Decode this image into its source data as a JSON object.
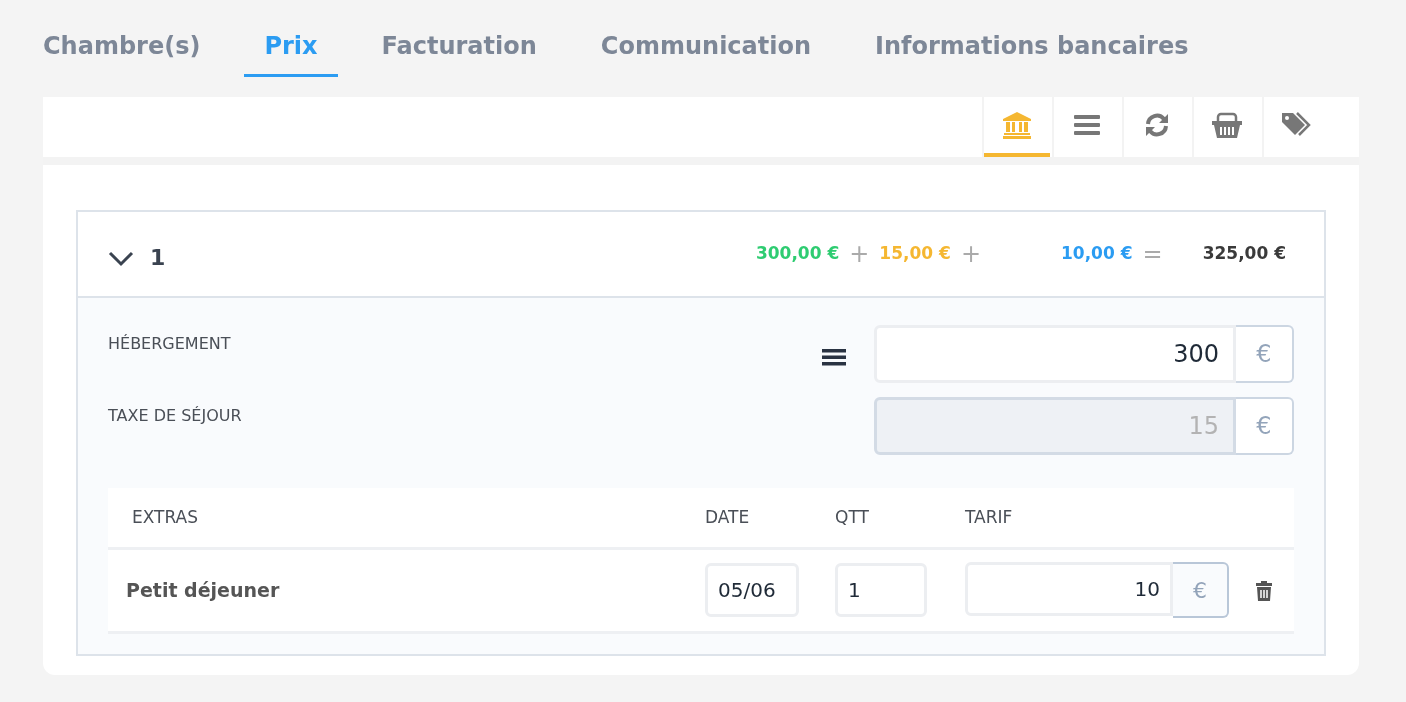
{
  "tabs": [
    {
      "label": "Chambre(s)",
      "selected": false
    },
    {
      "label": "Prix",
      "selected": true
    },
    {
      "label": "Facturation",
      "selected": false
    },
    {
      "label": "Communication",
      "selected": false
    },
    {
      "label": "Informations bancaires",
      "selected": false
    }
  ],
  "toolbar": [
    {
      "kind": "bank",
      "selected": true
    },
    {
      "kind": "list",
      "selected": false
    },
    {
      "kind": "refresh",
      "selected": false
    },
    {
      "kind": "basket",
      "selected": false
    },
    {
      "kind": "tags",
      "selected": false
    }
  ],
  "room": {
    "number": "1",
    "expanded": true,
    "summary": [
      {
        "amount": "300,00 €",
        "color": "#2ecc71",
        "operator": "+"
      },
      {
        "amount": "15,00 €",
        "color": "#f5b731",
        "operator": "+"
      },
      {
        "amount": "10,00 €",
        "color": "#2b9cf2",
        "operator": "="
      }
    ],
    "total": "325,00 €",
    "fields": [
      {
        "label": "HÉBERGEMENT",
        "value": "300",
        "unit": "€",
        "disabled": false,
        "has_menu": true
      },
      {
        "label": "TAXE DE SÉJOUR",
        "value": "15",
        "unit": "€",
        "disabled": true,
        "has_menu": false
      }
    ],
    "extras": {
      "columns": [
        "EXTRAS",
        "DATE",
        "QTT",
        "TARIF"
      ],
      "rows": [
        {
          "name": "Petit déjeuner",
          "date": "05/06",
          "qty": "1",
          "price": "10",
          "unit": "€"
        }
      ]
    }
  }
}
